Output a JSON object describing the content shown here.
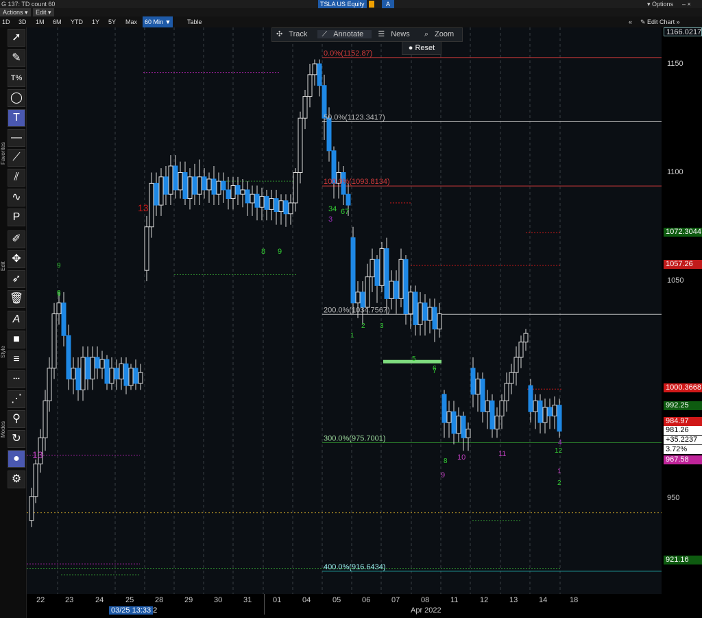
{
  "top": {
    "left_text": "G 137: TD count 60",
    "ticker": "TSLA US Equity",
    "ticker_btn": "A",
    "options": "Options",
    "actions": "Actions",
    "edit": "Edit"
  },
  "timeframes": [
    "1D",
    "3D",
    "1M",
    "6M",
    "YTD",
    "1Y",
    "5Y",
    "Max"
  ],
  "timeframe_selected": "60 Min",
  "table_label": "Table",
  "edit_chart": "Edit Chart",
  "annotate_bar": {
    "track": "Track",
    "annotate": "Annotate",
    "news": "News",
    "zoom": "Zoom",
    "reset": "Reset"
  },
  "side_labels": {
    "favorites": "Favorites",
    "edit": "Edit",
    "style": "Style",
    "modes": "Modes"
  },
  "price_axis": {
    "ticks": [
      "1150",
      "1100",
      "1050",
      "950"
    ],
    "tags": [
      {
        "text": "1166.0217",
        "bg": "#0b0f14",
        "fg": "#ddd",
        "border": "#7aa"
      },
      {
        "text": "1072.3044",
        "bg": "#0e5b10",
        "fg": "#fff"
      },
      {
        "text": "1057.26",
        "bg": "#c11b1b",
        "fg": "#fff"
      },
      {
        "text": "1000.3668",
        "bg": "#d01818",
        "fg": "#fff"
      },
      {
        "text": "992.25",
        "bg": "#0e5b10",
        "fg": "#fff"
      },
      {
        "text": "984.97",
        "bg": "#d01818",
        "fg": "#fff"
      },
      {
        "text": "981.26",
        "bg": "#fff",
        "fg": "#000"
      },
      {
        "text": "+35.2237",
        "bg": "#fff",
        "fg": "#000"
      },
      {
        "text": "3.72%",
        "bg": "#fff",
        "fg": "#000"
      },
      {
        "text": "967.58",
        "bg": "#c0249a",
        "fg": "#fff"
      },
      {
        "text": "921.16",
        "bg": "#0e5b10",
        "fg": "#fff"
      }
    ]
  },
  "date_axis": {
    "labels": [
      "22",
      "23",
      "24",
      "25",
      "28",
      "29",
      "30",
      "31",
      "01",
      "04",
      "05",
      "06",
      "07",
      "08",
      "11",
      "12",
      "13",
      "14",
      "18"
    ],
    "cursor_date": "03/25 13:33",
    "cursor_suffix": "2",
    "month_label": "Apr 2022"
  },
  "fib_labels": [
    {
      "text": "0.0%(1152.87)",
      "color": "#d23a3a"
    },
    {
      "text": "50.0%(1123.3417)",
      "color": "#bbb"
    },
    {
      "text": "100.0%(1093.8134)",
      "color": "#d23a3a"
    },
    {
      "text": "200.0%(1034.7567)",
      "color": "#bbb"
    },
    {
      "text": "300.0%(975.7001)",
      "color": "#9edc9e"
    },
    {
      "text": "400.0%(916.6434)",
      "color": "#9ee"
    }
  ],
  "td_labels": [
    "13",
    "9",
    "8",
    "9",
    "13",
    "8",
    "9",
    "34",
    "3",
    "67",
    "1",
    "2",
    "3",
    "5",
    "6",
    "7",
    "8",
    "9",
    "10",
    "11",
    "12",
    "1",
    "2",
    "4"
  ]
}
